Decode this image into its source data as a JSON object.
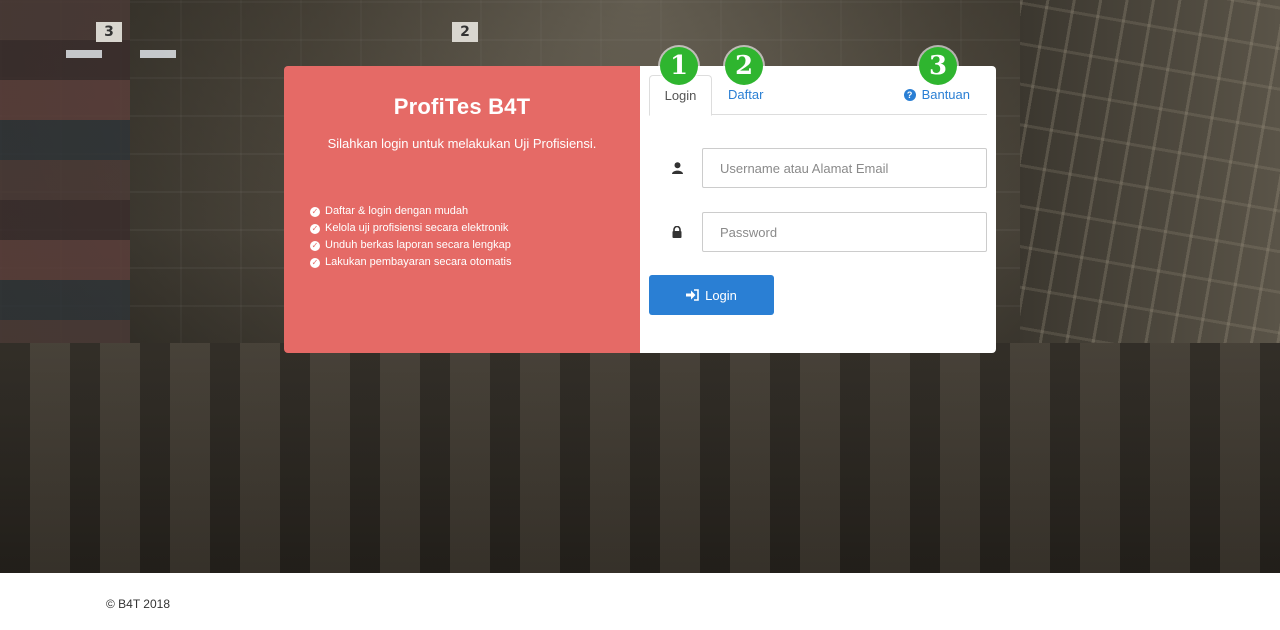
{
  "card": {
    "title": "ProfiTes B4T",
    "subtitle": "Silahkan login untuk melakukan Uji Profisiensi.",
    "features": [
      "Daftar & login dengan mudah",
      "Kelola uji profisiensi secara elektronik",
      "Unduh berkas laporan secara lengkap",
      "Lakukan pembayaran secara otomatis"
    ]
  },
  "tabs": {
    "login": "Login",
    "daftar": "Daftar",
    "bantuan": "Bantuan"
  },
  "markers": [
    "1",
    "2",
    "3"
  ],
  "form": {
    "username_placeholder": "Username atau Alamat Email",
    "password_placeholder": "Password",
    "submit_label": "Login"
  },
  "footer": {
    "copyright": "© B4T 2018"
  },
  "colors": {
    "panel_left": "#e56a66",
    "accent_blue": "#2a7fd4",
    "marker_green": "#2fb52f"
  },
  "icons": {
    "feature_bullet": "check-circle-icon",
    "username": "user-icon",
    "password": "lock-icon",
    "help": "question-circle-icon",
    "submit": "sign-in-icon"
  }
}
